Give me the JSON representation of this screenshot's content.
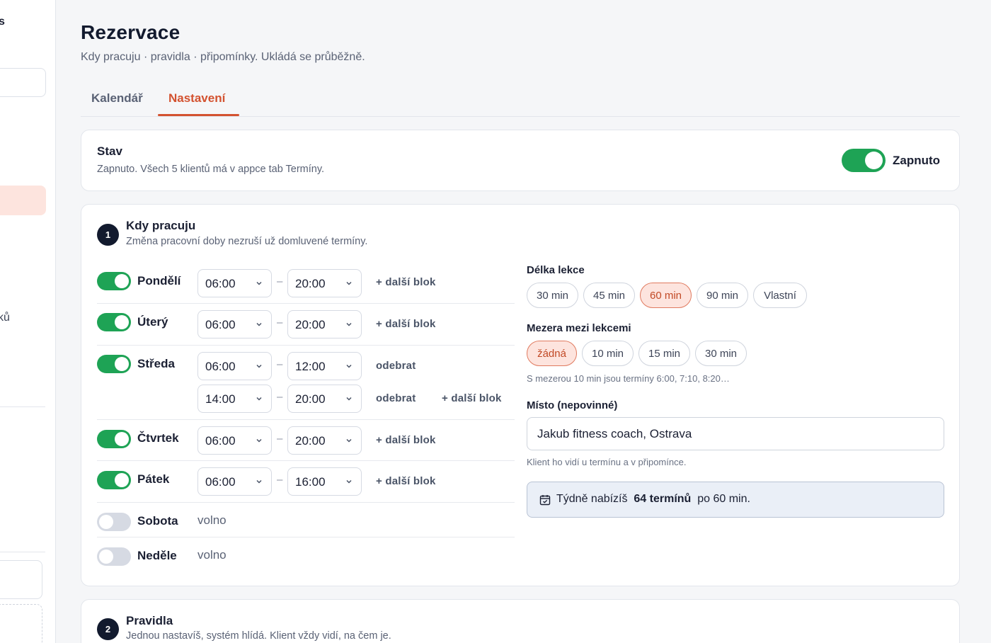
{
  "sidebar": {
    "logo_fragment": "s",
    "item_fragment": "ků"
  },
  "header": {
    "title": "Rezervace",
    "subtitle": "Kdy pracuju · pravidla · připomínky. Ukládá se průběžně."
  },
  "tabs": [
    {
      "label": "Kalendář",
      "active": false
    },
    {
      "label": "Nastavení",
      "active": true
    }
  ],
  "status": {
    "title": "Stav",
    "description": "Zapnuto. Všech 5 klientů má v appce tab Termíny.",
    "toggle_on": true,
    "state_label": "Zapnuto"
  },
  "schedule": {
    "step": "1",
    "title": "Kdy pracuju",
    "description": "Změna pracovní doby nezruší už domluvené termíny.",
    "days": [
      {
        "name": "Pondělí",
        "on": true,
        "blocks": [
          {
            "from": "06:00",
            "to": "20:00",
            "action": "+ další blok"
          }
        ]
      },
      {
        "name": "Úterý",
        "on": true,
        "blocks": [
          {
            "from": "06:00",
            "to": "20:00",
            "action": "+ další blok"
          }
        ]
      },
      {
        "name": "Středa",
        "on": true,
        "blocks": [
          {
            "from": "06:00",
            "to": "12:00",
            "action": "odebrat"
          },
          {
            "from": "14:00",
            "to": "20:00",
            "action": "odebrat",
            "extra": "+ další blok"
          }
        ]
      },
      {
        "name": "Čtvrtek",
        "on": true,
        "blocks": [
          {
            "from": "06:00",
            "to": "20:00",
            "action": "+ další blok"
          }
        ]
      },
      {
        "name": "Pátek",
        "on": true,
        "blocks": [
          {
            "from": "06:00",
            "to": "16:00",
            "action": "+ další blok"
          }
        ]
      },
      {
        "name": "Sobota",
        "on": false,
        "off_label": "volno"
      },
      {
        "name": "Neděle",
        "on": false,
        "off_label": "volno"
      }
    ],
    "dash": "–",
    "lesson_length": {
      "label": "Délka lekce",
      "options": [
        "30 min",
        "45 min",
        "60 min",
        "90 min",
        "Vlastní"
      ],
      "selected": "60 min"
    },
    "gap": {
      "label": "Mezera mezi lekcemi",
      "options": [
        "žádná",
        "10 min",
        "15 min",
        "30 min"
      ],
      "selected": "žádná",
      "hint": "S mezerou 10 min jsou termíny 6:00, 7:10, 8:20…"
    },
    "place": {
      "label": "Místo (nepovinné)",
      "value": "Jakub fitness coach, Ostrava",
      "hint": "Klient ho vidí u termínu a v připomínce."
    },
    "summary": {
      "prefix": "Týdně nabízíš",
      "count": "64 termínů",
      "suffix": "po 60 min."
    }
  },
  "rules": {
    "step": "2",
    "title": "Pravidla",
    "description": "Jednou nastavíš, systém hlídá. Klient vždy vidí, na čem je."
  }
}
